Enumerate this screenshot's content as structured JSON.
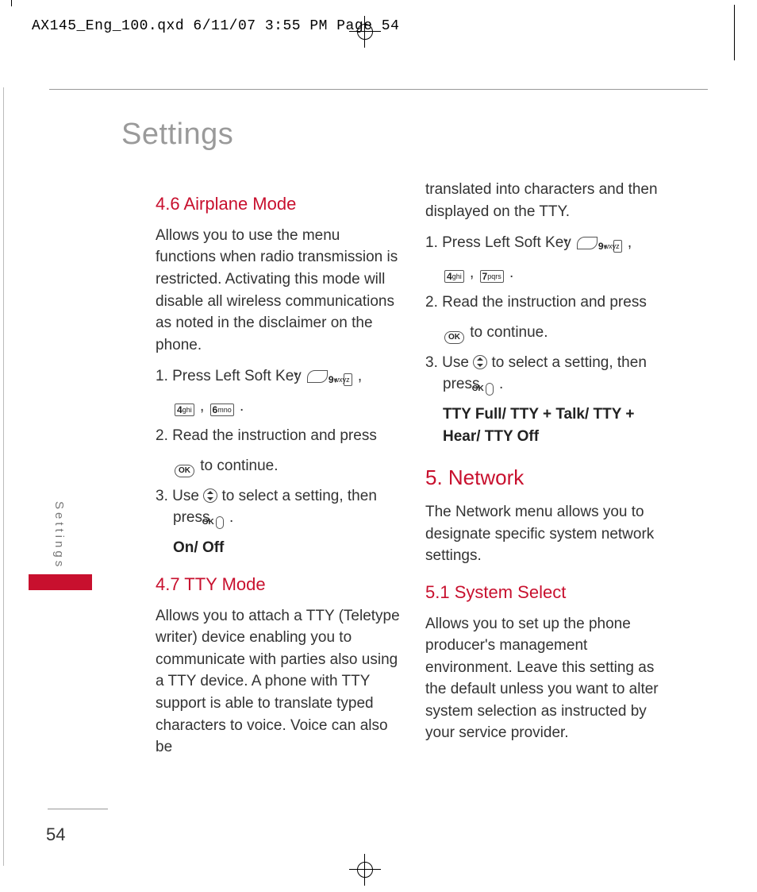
{
  "header": "AX145_Eng_100.qxd  6/11/07  3:55 PM  Page 54",
  "pageTitle": "Settings",
  "sideTab": "Settings",
  "pageNumber": "54",
  "left": {
    "h46": "4.6 Airplane Mode",
    "p46": "Allows you to use the menu functions when radio transmission is restricted. Activating this mode will disable all wireless communications as noted in the disclaimer on the phone.",
    "s46_1a": "1. Press Left Soft Key ",
    "s46_1b": " , ",
    "s46_1c": " ,",
    "s46_1d": " , ",
    "s46_1e": " .",
    "s46_2a": "2. Read the instruction and press ",
    "s46_2b": " to continue.",
    "s46_3a": "3. Use ",
    "s46_3b": " to select a setting, then press ",
    "s46_3c": " .",
    "s46_3d": "On/ Off",
    "h47": "4.7 TTY Mode",
    "p47": "Allows you to attach a TTY (Teletype writer) device enabling you to communicate with parties also using a TTY device. A phone with TTY support is able to translate typed characters to voice. Voice can also be"
  },
  "right": {
    "p_cont": "translated into characters and then displayed on the TTY.",
    "s47_1a": "1. Press Left Soft Key ",
    "s47_1b": " , ",
    "s47_1c": " ,",
    "s47_1d": " , ",
    "s47_1e": " .",
    "s47_2a": "2. Read the instruction and press ",
    "s47_2b": " to continue.",
    "s47_3a": "3. Use ",
    "s47_3b": " to select a setting, then press ",
    "s47_3c": " .",
    "s47_3d": "TTY Full/ TTY + Talk/ TTY + Hear/ TTY Off",
    "h5": "5. Network",
    "p5": "The Network menu allows you to designate specific system network settings.",
    "h51": "5.1 System Select",
    "p51": "Allows you to set up the phone producer's management environment. Leave this setting as the default unless you want to alter system selection as instructed by your service provider."
  },
  "keys": {
    "k9d": "9",
    "k9l": "wxyz",
    "k4d": "4",
    "k4l": "ghi",
    "k6d": "6",
    "k6l": "mno",
    "k7d": "7",
    "k7l": "pqrs",
    "ok": "OK"
  }
}
